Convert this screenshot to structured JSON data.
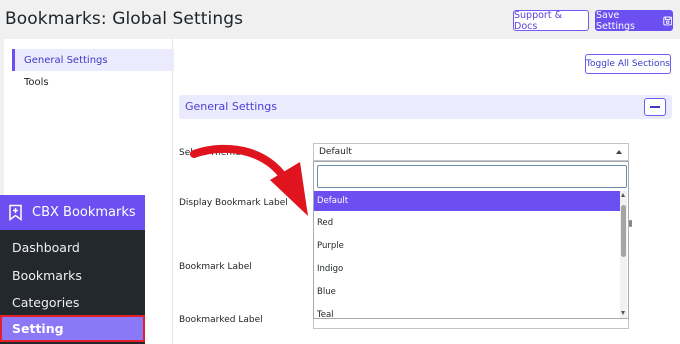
{
  "page": {
    "title": "Bookmarks: Global Settings"
  },
  "header": {
    "support_label": "Support & Docs",
    "save_label": "Save Settings"
  },
  "side_nav": {
    "items": [
      {
        "label": "General Settings",
        "active": true
      },
      {
        "label": "Tools",
        "active": false
      }
    ]
  },
  "toolbar": {
    "toggle_all_label": "Toggle All Sections"
  },
  "section": {
    "title": "General Settings",
    "collapse_icon": "minus-icon"
  },
  "fields": {
    "select_theme_label": "Select Theme",
    "display_bookmark_label": "Display Bookmark Label",
    "bookmark_label": "Bookmark Label",
    "bookmarked_label": "Bookmarked Label"
  },
  "theme_select": {
    "value": "Default",
    "search_value": "",
    "options": [
      "Default",
      "Red",
      "Purple",
      "Indigo",
      "Blue",
      "Teal"
    ],
    "highlighted": "Default"
  },
  "plugin_menu": {
    "title": "CBX Bookmarks",
    "icon": "bookmark-icon",
    "items": [
      {
        "label": "Dashboard"
      },
      {
        "label": "Bookmarks"
      },
      {
        "label": "Categories"
      },
      {
        "label": "Setting",
        "active": true
      }
    ]
  },
  "colors": {
    "accent": "#6b4ff0",
    "menu_bg": "#23282d",
    "highlight_border": "#e2202a",
    "arrow": "#e0141e"
  }
}
